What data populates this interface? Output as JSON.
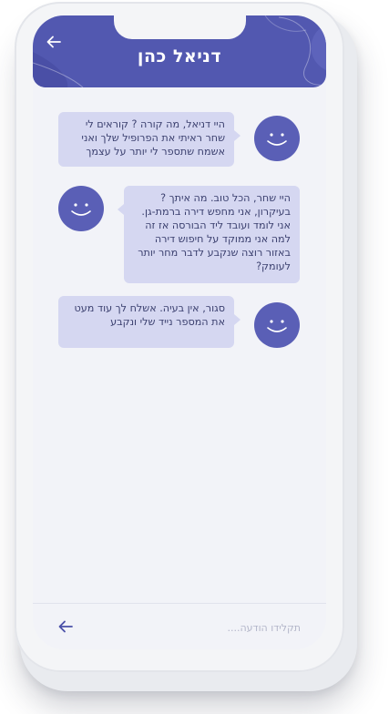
{
  "header": {
    "title": "דניאל כהן",
    "back_icon": "arrow-left-icon"
  },
  "messages": [
    {
      "side": "right",
      "text": "היי דניאל, מה קורה ? קוראים לי שחר ראיתי את הפרופיל שלך ואני אשמח שתספר לי יותר על עצמך"
    },
    {
      "side": "left",
      "text": "היי שחר, הכל טוב. מה איתך ? בעיקרון, אני מחפש דירה ברמת-גן. אני לומד ועובד ליד הבורסה אז זה למה אני ממוקד על חיפוש דירה באזור רוצה שנקבע לדבר מחר יותר לעומק?"
    },
    {
      "side": "right",
      "text": "סגור, אין בעיה. אשלח לך עוד מעט את המספר נייד שלי ונקבע"
    }
  ],
  "avatar_icon": "smiley-face-icon",
  "input": {
    "placeholder": "תקלידו הודעה....",
    "value": ""
  },
  "send_icon": "arrow-left-icon",
  "colors": {
    "accent": "#5258b0",
    "bubble": "#d5d7f1",
    "background": "#f2f3f8"
  }
}
